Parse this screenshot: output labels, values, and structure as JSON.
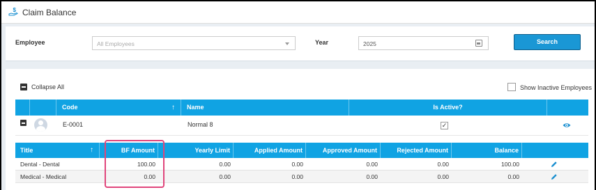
{
  "page": {
    "title": "Claim Balance",
    "title_icon": "hand-dollar-icon"
  },
  "filters": {
    "employee_label": "Employee",
    "employee_placeholder": "All Employees",
    "year_label": "Year",
    "year_value": "2025",
    "search_label": "Search"
  },
  "controls": {
    "collapse_label": "Collapse All",
    "inactive_label": "Show Inactive Employees"
  },
  "employee_table": {
    "headers": [
      "Code",
      "Name",
      "Is Active?"
    ],
    "rows": [
      {
        "code": "E-0001",
        "name": "Normal 8",
        "active_mark": "✓"
      }
    ]
  },
  "claim_table": {
    "headers": [
      "Title",
      "BF Amount",
      "Yearly Limit",
      "Applied Amount",
      "Approved Amount",
      "Rejected Amount",
      "Balance"
    ],
    "sort_icon": "↑",
    "rows": [
      {
        "title": "Dental - Dental",
        "bf": "100.00",
        "limit": "0.00",
        "applied": "0.00",
        "approved": "0.00",
        "rejected": "0.00",
        "balance": "100.00"
      },
      {
        "title": "Medical - Medical",
        "bf": "0.00",
        "limit": "0.00",
        "applied": "0.00",
        "approved": "0.00",
        "rejected": "0.00",
        "balance": "0.00"
      }
    ]
  },
  "colors": {
    "accent": "#10a3e3",
    "highlight": "#e0457b"
  }
}
